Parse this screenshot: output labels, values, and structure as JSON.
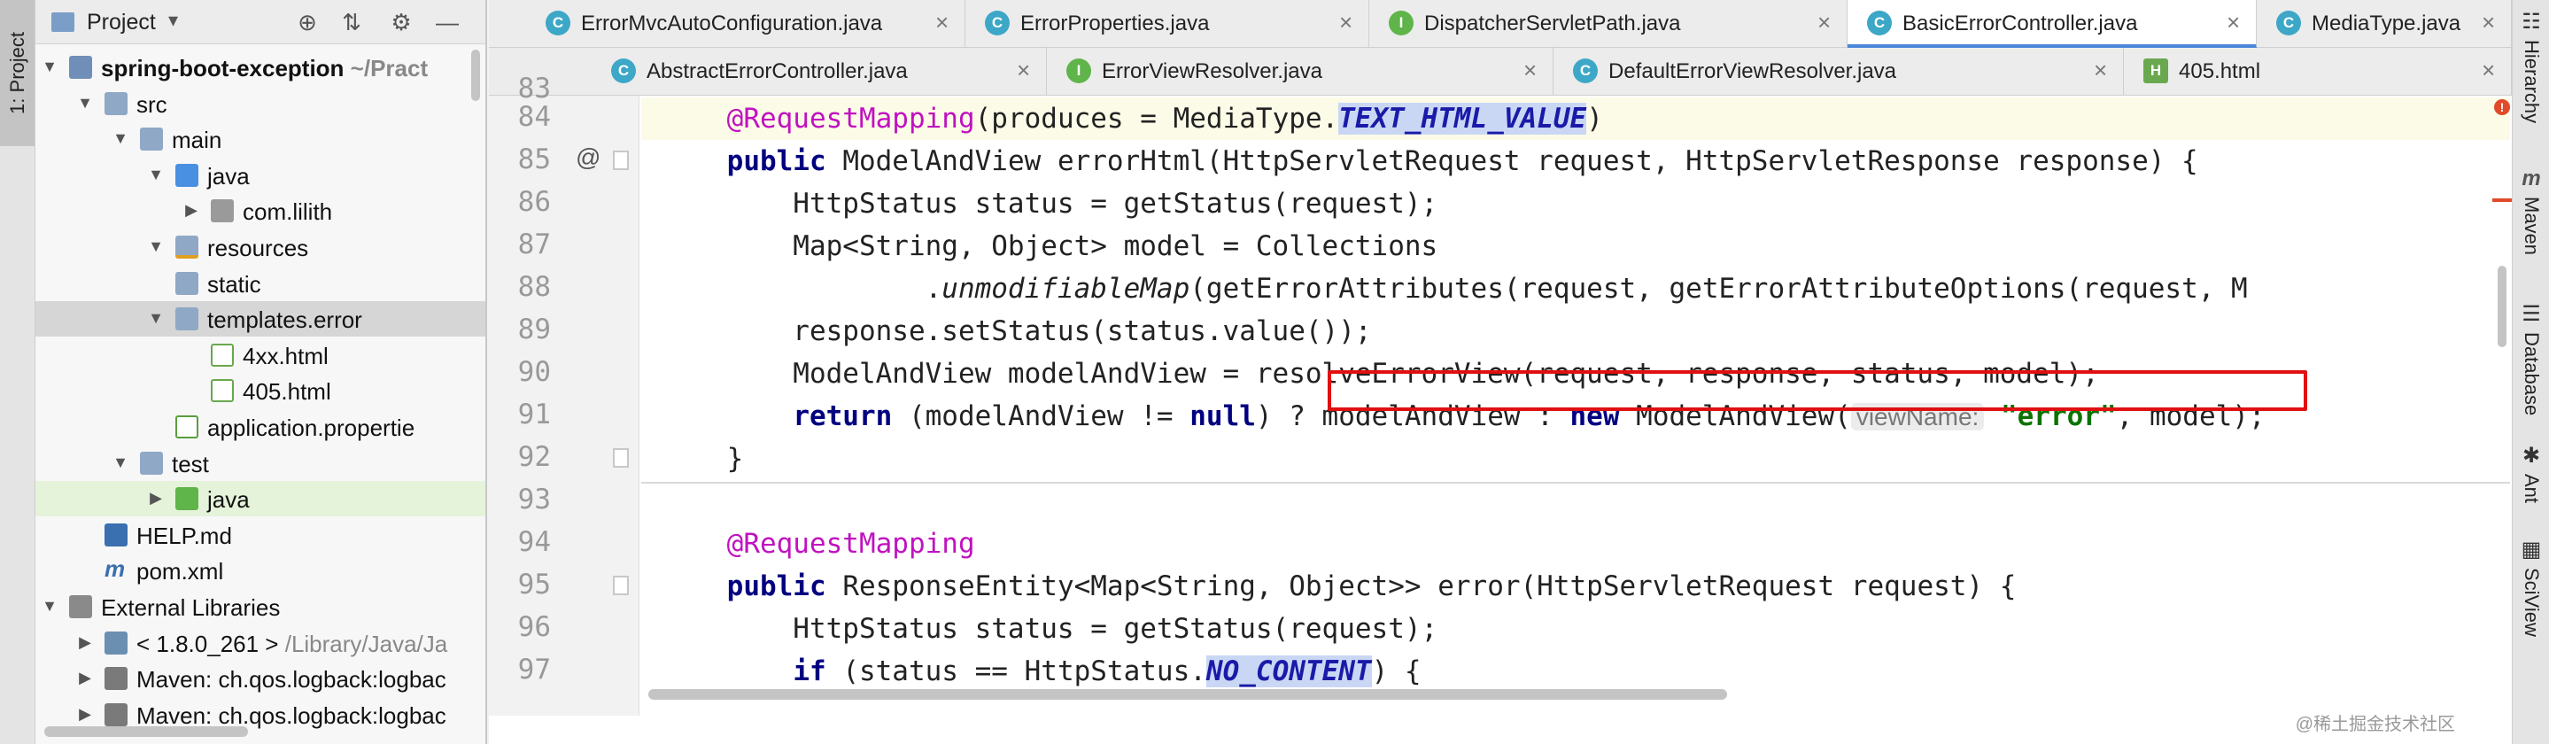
{
  "sidebar": {
    "tool_tab": "1: Project",
    "title": "Project",
    "tree": [
      {
        "label": "spring-boot-exception",
        "suffix": "~/Pract",
        "icon": "module-folder-icon",
        "expanded": true
      },
      {
        "label": "src",
        "icon": "folder-icon",
        "expanded": true
      },
      {
        "label": "main",
        "icon": "folder-icon",
        "expanded": true
      },
      {
        "label": "java",
        "icon": "source-folder-icon",
        "expanded": true
      },
      {
        "label": "com.lilith",
        "icon": "package-icon",
        "expanded": false
      },
      {
        "label": "resources",
        "icon": "resources-folder-icon",
        "expanded": true
      },
      {
        "label": "static",
        "icon": "folder-icon",
        "expanded": null
      },
      {
        "label": "templates.error",
        "icon": "folder-icon",
        "expanded": true
      },
      {
        "label": "4xx.html",
        "icon": "html-file-icon",
        "expanded": null
      },
      {
        "label": "405.html",
        "icon": "html-file-icon",
        "expanded": null
      },
      {
        "label": "application.propertie",
        "icon": "properties-file-icon",
        "expanded": null
      },
      {
        "label": "test",
        "icon": "folder-icon",
        "expanded": true
      },
      {
        "label": "java",
        "icon": "test-source-folder-icon",
        "expanded": false
      },
      {
        "label": "HELP.md",
        "icon": "markdown-file-icon",
        "expanded": null
      },
      {
        "label": "pom.xml",
        "icon": "maven-file-icon",
        "expanded": null
      },
      {
        "label": "External Libraries",
        "icon": "libraries-icon",
        "expanded": true
      },
      {
        "label": "< 1.8.0_261 >",
        "suffix": "/Library/Java/Ja",
        "icon": "jdk-icon",
        "expanded": false
      },
      {
        "label": "Maven: ch.qos.logback:logbac",
        "icon": "library-icon",
        "expanded": false
      },
      {
        "label": "Maven: ch.qos.logback:logbac",
        "icon": "library-icon",
        "expanded": false
      }
    ]
  },
  "tabs_row1": [
    {
      "label": "ErrorMvcAutoConfiguration.java",
      "icon": "class-icon",
      "letter": "C",
      "active": false
    },
    {
      "label": "ErrorProperties.java",
      "icon": "class-icon",
      "letter": "C",
      "active": false
    },
    {
      "label": "DispatcherServletPath.java",
      "icon": "interface-icon",
      "letter": "I",
      "active": false
    },
    {
      "label": "BasicErrorController.java",
      "icon": "class-icon",
      "letter": "C",
      "active": true
    },
    {
      "label": "MediaType.java",
      "icon": "class-icon",
      "letter": "C",
      "active": false
    }
  ],
  "tabs_row2": [
    {
      "label": "AbstractErrorController.java",
      "icon": "abstract-class-icon",
      "letter": "C",
      "active": false
    },
    {
      "label": "ErrorViewResolver.java",
      "icon": "interface-icon",
      "letter": "I",
      "active": false
    },
    {
      "label": "DefaultErrorViewResolver.java",
      "icon": "class-icon",
      "letter": "C",
      "active": false
    },
    {
      "label": "405.html",
      "icon": "html-file-icon",
      "letter": "H",
      "active": false
    }
  ],
  "code": {
    "partial_line": "83",
    "lines": [
      {
        "num": "84",
        "mark": "",
        "segments": [
          [
            "    ",
            ""
          ],
          [
            "@RequestMapping",
            "ann"
          ],
          [
            "(produces = MediaType.",
            ""
          ],
          [
            "TEXT_HTML_VALUE",
            "cst"
          ],
          [
            ")",
            ""
          ]
        ]
      },
      {
        "num": "85",
        "mark": "@",
        "segments": [
          [
            "    ",
            ""
          ],
          [
            "public ",
            "kw"
          ],
          [
            "ModelAndView errorHtml(HttpServletRequest request, HttpServletResponse response) {",
            ""
          ]
        ]
      },
      {
        "num": "86",
        "mark": "",
        "segments": [
          [
            "        HttpStatus status = getStatus(request);",
            ""
          ]
        ]
      },
      {
        "num": "87",
        "mark": "",
        "segments": [
          [
            "        Map<String, Object> model = Collections",
            ""
          ]
        ]
      },
      {
        "num": "88",
        "mark": "",
        "segments": [
          [
            "                .",
            ""
          ],
          [
            "unmodifiableMap",
            "it"
          ],
          [
            "(getErrorAttributes(request, getErrorAttributeOptions(request, M",
            ""
          ]
        ]
      },
      {
        "num": "89",
        "mark": "",
        "segments": [
          [
            "        response.setStatus(status.value());",
            ""
          ]
        ]
      },
      {
        "num": "90",
        "mark": "",
        "segments": [
          [
            "        ModelAndView modelAndView = resolveErrorView(request, response, status, model);",
            ""
          ]
        ]
      },
      {
        "num": "91",
        "mark": "",
        "segments": [
          [
            "        ",
            ""
          ],
          [
            "return ",
            "kw"
          ],
          [
            "(modelAndView != ",
            ""
          ],
          [
            "null",
            "kw"
          ],
          [
            ") ? modelAndView : ",
            ""
          ],
          [
            "new ",
            "kw"
          ],
          [
            "ModelAndView(",
            ""
          ],
          [
            "viewName:",
            "hint"
          ],
          [
            " ",
            ""
          ],
          [
            "\"error\"",
            "str"
          ],
          [
            ", model);",
            ""
          ]
        ]
      },
      {
        "num": "92",
        "mark": "",
        "segments": [
          [
            "    }",
            ""
          ]
        ]
      },
      {
        "num": "93",
        "mark": "",
        "segments": [
          [
            "",
            ""
          ]
        ]
      },
      {
        "num": "94",
        "mark": "",
        "segments": [
          [
            "    ",
            ""
          ],
          [
            "@RequestMapping",
            "ann"
          ]
        ]
      },
      {
        "num": "95",
        "mark": "",
        "segments": [
          [
            "    ",
            ""
          ],
          [
            "public ",
            "kw"
          ],
          [
            "ResponseEntity<Map<String, Object>> error(HttpServletRequest request) {",
            ""
          ]
        ]
      },
      {
        "num": "96",
        "mark": "",
        "segments": [
          [
            "        HttpStatus status = getStatus(request);",
            ""
          ]
        ]
      },
      {
        "num": "97",
        "mark": "",
        "segments": [
          [
            "        ",
            ""
          ],
          [
            "if ",
            "kw"
          ],
          [
            "(status == HttpStatus.",
            ""
          ],
          [
            "NO_CONTENT",
            "cst"
          ],
          [
            ") {",
            ""
          ]
        ]
      }
    ]
  },
  "right_tools": [
    "Hierarchy",
    "Maven",
    "Database",
    "Ant",
    "SciView"
  ],
  "watermark": "@稀土掘金技术社区",
  "colors": {
    "annotation": "#c012c0",
    "keyword": "#000080",
    "string": "#0b7300",
    "highlight_box": "#e01010",
    "active_tab_underline": "#4a86d8"
  }
}
